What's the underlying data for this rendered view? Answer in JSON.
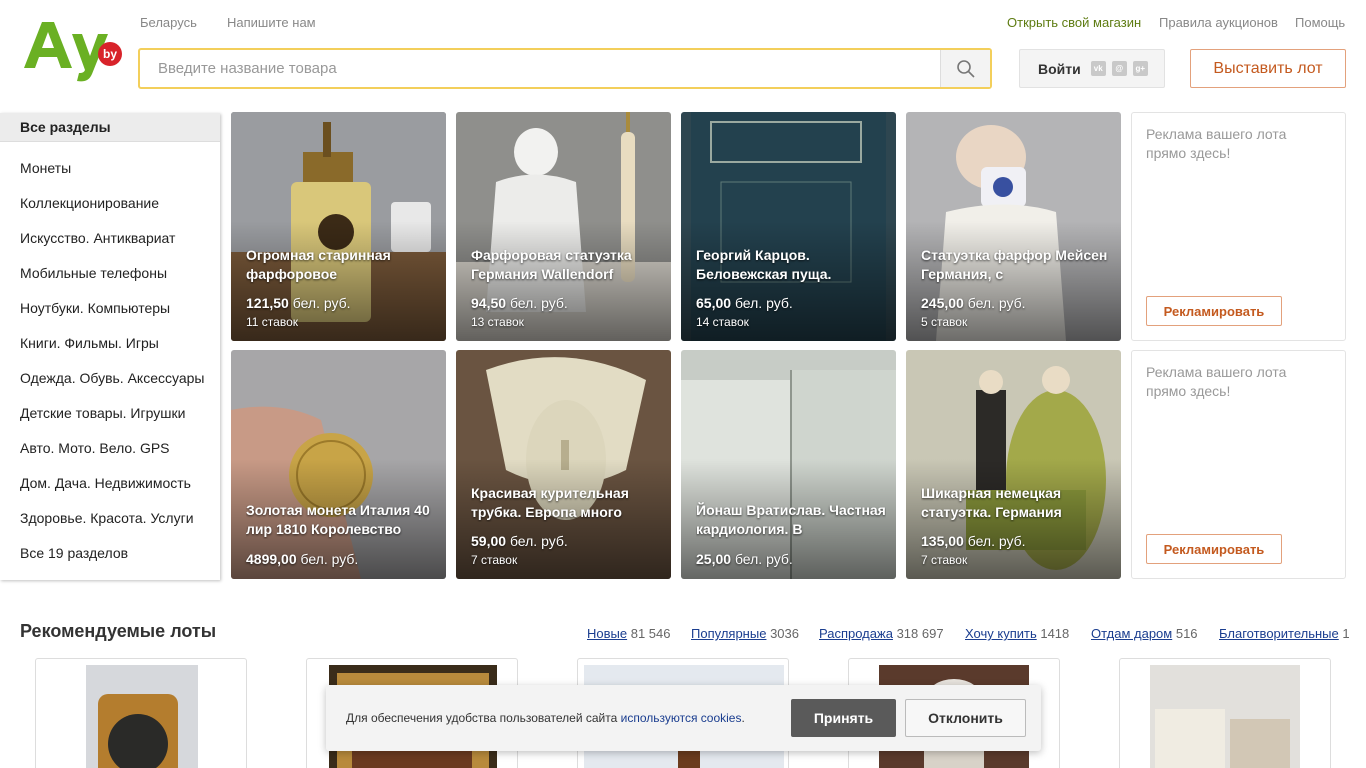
{
  "header": {
    "logo_text": "Ау",
    "logo_badge": "by",
    "top_left_links": [
      "Беларусь",
      "Напишите нам"
    ],
    "top_right_links": [
      {
        "label": "Открыть свой магазин",
        "color": "#5e7c12"
      },
      {
        "label": "Правила аукционов",
        "color": "#888888"
      },
      {
        "label": "Помощь",
        "color": "#888888"
      }
    ],
    "search_placeholder": "Введите название товара",
    "login_label": "Войти",
    "post_lot_label": "Выставить лот"
  },
  "sidebar": {
    "title": "Все разделы",
    "items": [
      "Монеты",
      "Коллекционирование",
      "Искусство. Антиквариат",
      "Мобильные телефоны",
      "Ноутбуки. Компьютеры",
      "Книги. Фильмы. Игры",
      "Одежда. Обувь. Аксессуары",
      "Детские товары. Игрушки",
      "Авто. Мото. Вело. GPS",
      "Дом. Дача. Недвижимость",
      "Здоровье. Красота. Услуги",
      "Все 19 разделов"
    ]
  },
  "tiles": [
    {
      "title": "Огромная старинная фарфоровое",
      "price": "121,50",
      "currency": "бел. руб.",
      "bids": "11 ставок"
    },
    {
      "title": "Фарфоровая статуэтка Германия Wallendorf",
      "price": "94,50",
      "currency": "бел. руб.",
      "bids": "13 ставок"
    },
    {
      "title": "Георгий Карцов. Беловежская пуща.",
      "price": "65,00",
      "currency": "бел. руб.",
      "bids": "14 ставок"
    },
    {
      "title": "Статуэтка фарфор Мейсен Германия, с",
      "price": "245,00",
      "currency": "бел. руб.",
      "bids": "5 ставок"
    },
    {
      "title": "Золотая монета Италия 40 лир 1810 Королевство",
      "price": "4899,00",
      "currency": "бел. руб.",
      "bids": ""
    },
    {
      "title": "Красивая курительная трубка. Европа много",
      "price": "59,00",
      "currency": "бел. руб.",
      "bids": "7 ставок"
    },
    {
      "title": "Йонаш Вратислав. Частная кардиология. В",
      "price": "25,00",
      "currency": "бел. руб.",
      "bids": ""
    },
    {
      "title": "Шикарная немецкая статуэтка. Германия",
      "price": "135,00",
      "currency": "бел. руб.",
      "bids": "7 ставок"
    }
  ],
  "ads": [
    {
      "text": "Реклама вашего лота прямо здесь!",
      "button": "Рекламировать"
    },
    {
      "text": "Реклама вашего лота прямо здесь!",
      "button": "Рекламировать"
    }
  ],
  "recommended": {
    "title": "Рекомендуемые лоты",
    "filters": [
      {
        "label": "Новые",
        "count": "81 546"
      },
      {
        "label": "Популярные",
        "count": "3036"
      },
      {
        "label": "Распродажа",
        "count": "318 697"
      },
      {
        "label": "Хочу купить",
        "count": "1418"
      },
      {
        "label": "Отдам даром",
        "count": "516"
      },
      {
        "label": "Благотворительные",
        "count": "1"
      }
    ]
  },
  "cookie": {
    "text_before": "Для обеспечения удобства пользователей сайта ",
    "link": "используются cookies",
    "text_after": ".",
    "accept": "Принять",
    "decline": "Отклонить"
  },
  "colors": {
    "logo_green": "#6ab023",
    "logo_red": "#d8232a",
    "accent_orange": "#c45a1f",
    "search_border": "#f3cf5b",
    "link_blue": "#1a3d8f"
  }
}
